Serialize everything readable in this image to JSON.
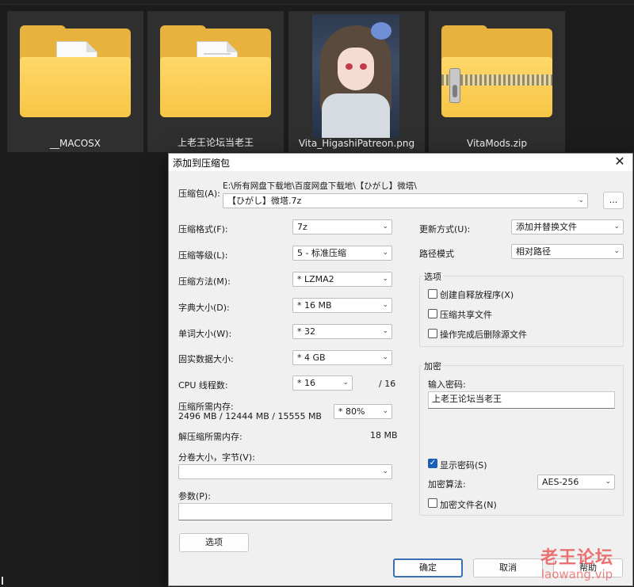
{
  "explorer": {
    "items": [
      {
        "name": "__MACOSX",
        "type": "folder"
      },
      {
        "name": "上老王论坛当老王",
        "type": "folder"
      },
      {
        "name": "Vita_HigashiPatreon.png",
        "type": "image"
      },
      {
        "name": "VitaMods.zip",
        "type": "zip"
      }
    ]
  },
  "dialog": {
    "title": "添加到压缩包",
    "archive": {
      "label": "压缩包(A):",
      "path": "E:\\所有网盘下载地\\百度网盘下载地\\【ひがし】微塔\\",
      "filename": "【ひがし】微塔.7z",
      "browse_label": "..."
    },
    "left": {
      "format": {
        "label": "压缩格式(F):",
        "value": "7z"
      },
      "level": {
        "label": "压缩等级(L):",
        "value": "5 - 标准压缩"
      },
      "method": {
        "label": "压缩方法(M):",
        "value": "* LZMA2"
      },
      "dict": {
        "label": "字典大小(D):",
        "value": "* 16 MB"
      },
      "word": {
        "label": "单词大小(W):",
        "value": "* 32"
      },
      "solid": {
        "label": "固实数据大小:",
        "value": "* 4 GB"
      },
      "threads": {
        "label": "CPU 线程数:",
        "value": "* 16",
        "total": "/ 16"
      },
      "mem_compress": {
        "label": "压缩所需内存:",
        "detail": "2496 MB / 12444 MB / 15555 MB",
        "value": "* 80%"
      },
      "mem_decompress": {
        "label": "解压缩所需内存:",
        "value": "18 MB"
      },
      "split": {
        "label": "分卷大小，字节(V):",
        "value": ""
      },
      "params": {
        "label": "参数(P):",
        "value": ""
      },
      "options_button": "选项"
    },
    "right": {
      "update": {
        "label": "更新方式(U):",
        "value": "添加并替换文件"
      },
      "pathmode": {
        "label": "路径模式",
        "value": "相对路径"
      },
      "options_group": {
        "title": "选项",
        "sfx": {
          "label": "创建自释放程序(X)",
          "checked": false
        },
        "shared": {
          "label": "压缩共享文件",
          "checked": false
        },
        "delete": {
          "label": "操作完成后删除源文件",
          "checked": false
        }
      },
      "encryption": {
        "title": "加密",
        "password_label": "输入密码:",
        "password_value": "上老王论坛当老王",
        "show_password": {
          "label": "显示密码(S)",
          "checked": true
        },
        "method_label": "加密算法:",
        "method_value": "AES-256",
        "encrypt_names": {
          "label": "加密文件名(N)",
          "checked": false
        }
      }
    },
    "buttons": {
      "ok": "确定",
      "cancel": "取消",
      "help": "帮助"
    }
  },
  "watermark": {
    "main": "老王论坛",
    "sub": "laowang.vip"
  }
}
